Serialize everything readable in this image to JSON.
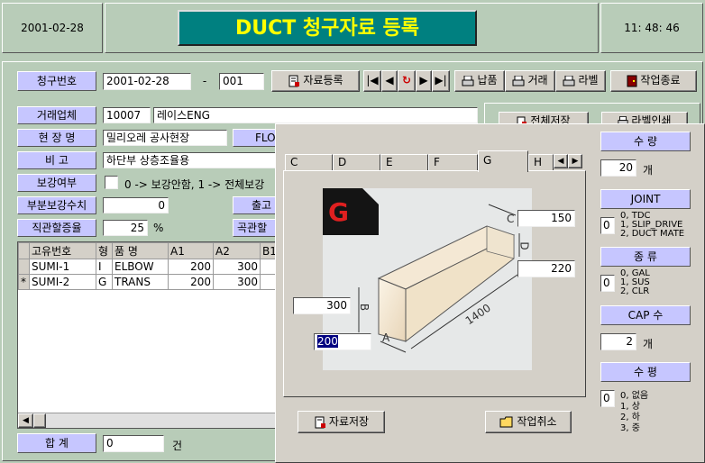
{
  "header": {
    "date": "2001-02-28",
    "title": "DUCT 청구자료 등록",
    "time": "11: 48: 46"
  },
  "claim": {
    "label": "청구번호",
    "date": "2001-02-28",
    "dash": "-",
    "number": "001"
  },
  "toolbar": {
    "register": "자료등록",
    "deliver": "납품",
    "trade": "거래",
    "label_print": "라벨",
    "exit": "작업종료"
  },
  "behind_toolbar": {
    "save_all": "전체저장",
    "label_print": "라벨인쇄"
  },
  "form": {
    "vendor_label": "거래업체",
    "vendor_code": "10007",
    "vendor_name": "레이스ENG",
    "site_label": "현 장 명",
    "site_value": "밀리오레 공사현장",
    "flo_label": "FLO",
    "note_label": "비    고",
    "note_value": "하단부 상층조율용",
    "reinforce_label": "보강여부",
    "reinforce_hint": "0 -> 보강안함, 1 -> 전체보강",
    "partial_label": "부분보강수치",
    "partial_value": "0",
    "out_label": "출고",
    "straight_label": "직관할증율",
    "straight_value": "25",
    "straight_unit": "%",
    "curve_label": "곡관할"
  },
  "grid": {
    "headers": [
      "고유번호",
      "형",
      "품  명",
      "A1",
      "A2",
      "B1"
    ],
    "rows": [
      {
        "marker": "",
        "id": "SUMI-1",
        "type": "I",
        "name": "ELBOW",
        "a1": "200",
        "a2": "300"
      },
      {
        "marker": "*",
        "id": "SUMI-2",
        "type": "G",
        "name": "TRANS",
        "a1": "200",
        "a2": "300"
      }
    ]
  },
  "total": {
    "label": "합    계",
    "value": "0",
    "unit": "건"
  },
  "modal": {
    "tabs": [
      "C",
      "D",
      "E",
      "F",
      "G",
      "H"
    ],
    "active_tab": "G",
    "diagram": {
      "badge": "G",
      "dim_b": "300",
      "dim_a": "200",
      "dim_c": "150",
      "dim_d": "220",
      "length": "1400",
      "labels": {
        "a": "A",
        "b": "B",
        "c": "C",
        "d": "D"
      }
    },
    "save": "자료저장",
    "cancel": "작업취소",
    "right": {
      "qty_label": "수    량",
      "qty_value": "20",
      "qty_unit": "개",
      "joint_label": "JOINT",
      "joint_value": "0",
      "joint_options": [
        "0, TDC",
        "1, SLIP_DRIVE",
        "2, DUCT MATE"
      ],
      "kind_label": "종    류",
      "kind_value": "0",
      "kind_options": [
        "0, GAL",
        "1, SUS",
        "2, CLR"
      ],
      "cap_label": "CAP 수",
      "cap_value": "2",
      "cap_unit": "개",
      "level_label": "수    평",
      "level_value": "0",
      "level_options": [
        "0, 없음",
        "1, 상",
        "2, 하",
        "3, 중"
      ]
    }
  },
  "colors": {
    "background": "#b8ccb8",
    "title_bg": "#008080",
    "title_text": "#ffff00",
    "label_bg": "#c6c6ff",
    "modal_bg": "#d4d0c8"
  }
}
